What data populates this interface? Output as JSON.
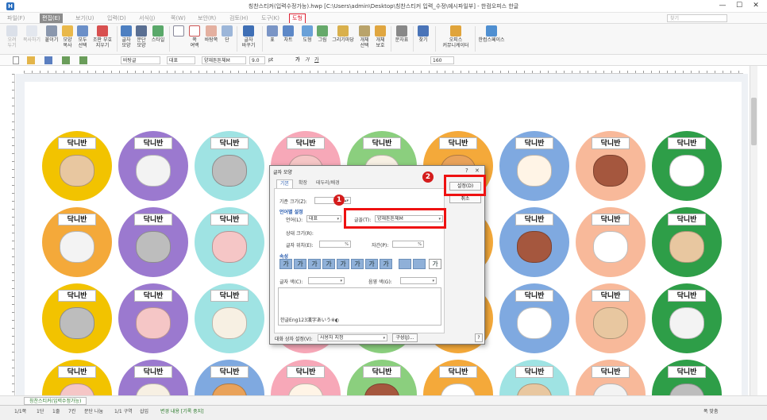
{
  "window": {
    "title": "칭찬스티커(입력수정가능).hwp [C:\\Users\\admin\\Desktop\\칭찬스티커 입력_수정\\예시파일부] - 한컴오피스 한글",
    "app_icon": "H",
    "minimize": "—",
    "maximize": "☐",
    "close": "✕"
  },
  "menubar": {
    "items": [
      "파일(F)",
      "편집(E)",
      "보기(U)",
      "입력(D)",
      "서식(J)",
      "쪽(W)",
      "보안(R)",
      "검토(H)",
      "도구(K)",
      "도형"
    ],
    "search_placeholder": "찾기"
  },
  "ribbon": {
    "groups": [
      {
        "label": "오려\n두기",
        "icon": "scissors-icon",
        "disabled": true
      },
      {
        "label": "복사하기",
        "icon": "copy-icon",
        "disabled": true
      },
      {
        "label": "붙이기",
        "icon": "paste-icon"
      },
      {
        "label": "모양\n복사",
        "icon": "format-painter-icon"
      },
      {
        "label": "모두\n선택",
        "icon": "select-all-icon"
      },
      {
        "label": "조판 부호\n지우기",
        "icon": "clear-codes-icon"
      },
      {
        "label": "글자\n모양",
        "icon": "char-shape-icon"
      },
      {
        "label": "문단\n모양",
        "icon": "para-shape-icon"
      },
      {
        "label": "스타일",
        "icon": "style-icon"
      },
      {
        "label": "",
        "icon": "page-icon"
      },
      {
        "label": "쪽\n여백",
        "icon": "margin-icon"
      },
      {
        "label": "바탕쪽",
        "icon": "master-page-icon"
      },
      {
        "label": "단",
        "icon": "columns-icon"
      },
      {
        "label": "글자\n바꾸기",
        "icon": "replace-char-icon"
      },
      {
        "label": "표",
        "icon": "table-icon"
      },
      {
        "label": "차트",
        "icon": "chart-icon"
      },
      {
        "label": "도형",
        "icon": "shape-icon"
      },
      {
        "label": "그림",
        "icon": "image-icon"
      },
      {
        "label": "그리기마당",
        "icon": "clipart-icon"
      },
      {
        "label": "개체\n선택",
        "icon": "object-select-icon"
      },
      {
        "label": "개체\n보호",
        "icon": "object-protect-icon"
      },
      {
        "label": "문자표",
        "icon": "symbol-icon"
      },
      {
        "label": "찾기",
        "icon": "find-icon"
      },
      {
        "label": "오피스\n커뮤니케이터",
        "icon": "communicator-icon"
      },
      {
        "label": "한컴스페이스",
        "icon": "hancom-space-icon"
      }
    ]
  },
  "format_bar": {
    "style": "바탕글",
    "lang": "대표",
    "font": "양재튼튼체M",
    "size": "9.0",
    "unit": "pt",
    "bold": "가",
    "italic": "가",
    "underline": "가",
    "zoom": "160"
  },
  "page": {
    "sticker_label": "닥니반",
    "rows": [
      [
        "#f2c300",
        "#9b79cf",
        "#9fe3e3",
        "#f7a8b8",
        "#8bcf7e",
        "#f4a93a",
        "#7fa9e0",
        "#f8b99a",
        "#2e9e48"
      ],
      [
        "#f4a93a",
        "#9b79cf",
        "#9fe3e3",
        "#f7a8b8",
        "#8bcf7e",
        "#f4a93a",
        "#7fa9e0",
        "#f8b99a",
        "#2e9e48"
      ],
      [
        "#f2c300",
        "#9b79cf",
        "#9fe3e3",
        "#f7a8b8",
        "#8bcf7e",
        "#f4a93a",
        "#7fa9e0",
        "#f8b99a",
        "#2e9e48"
      ],
      [
        "#f2c300",
        "#9b79cf",
        "#7fa9e0",
        "#f7a8b8",
        "#8bcf7e",
        "#f4a93a",
        "#9fe3e3",
        "#f8b99a",
        "#2e9e48"
      ]
    ]
  },
  "dialog": {
    "title": "글자 모양",
    "help": "?",
    "close": "✕",
    "tabs": [
      "기본",
      "확장",
      "테두리/배경"
    ],
    "base_size_label": "기준 크기(Z):",
    "base_size_value": "",
    "lang_section": "언어별 설정",
    "lang_label": "언어(L):",
    "lang_value": "대표",
    "font_label": "글꼴(T):",
    "font_value": "양재튼튼체M",
    "rel_size_label": "상대 크기(R):",
    "position_label": "글자 위치(E):",
    "position_unit": "%",
    "spacing_label": "자간(P):",
    "spacing_unit": "%",
    "attr_section": "속성",
    "attr_buttons": [
      "가",
      "가",
      "가",
      "가",
      "가",
      "가",
      "가",
      "가",
      "",
      "",
      "가"
    ],
    "text_color_label": "글자 색(C):",
    "shade_color_label": "음영 색(G):",
    "preview_text": "한글Eng123漢字あいう※◐",
    "dialog_style_label": "대화 상자 설정(V):",
    "dialog_style_value": "사용자 지정",
    "compose_button": "구성(J)...",
    "help_button": "?",
    "ok_button": "설정(D)",
    "cancel_button": "취소"
  },
  "annotations": {
    "badge1": "1",
    "badge2": "2"
  },
  "tabs": {
    "doc_tab": "칭찬스티커(입력수정가능)"
  },
  "status": {
    "page": "1/1쪽",
    "section": "1단",
    "line": "1줄",
    "col": "7칸",
    "para": "문단 나눔",
    "area": "1/1 구역",
    "insert": "삽입",
    "track": "변경 내용 [기록 중지]",
    "zoom_text": "폭 맞춤"
  },
  "colors": {
    "accent_red": "#e11111",
    "menu_active": "#d22233",
    "ribbon_bg": "#f7f7f7"
  }
}
